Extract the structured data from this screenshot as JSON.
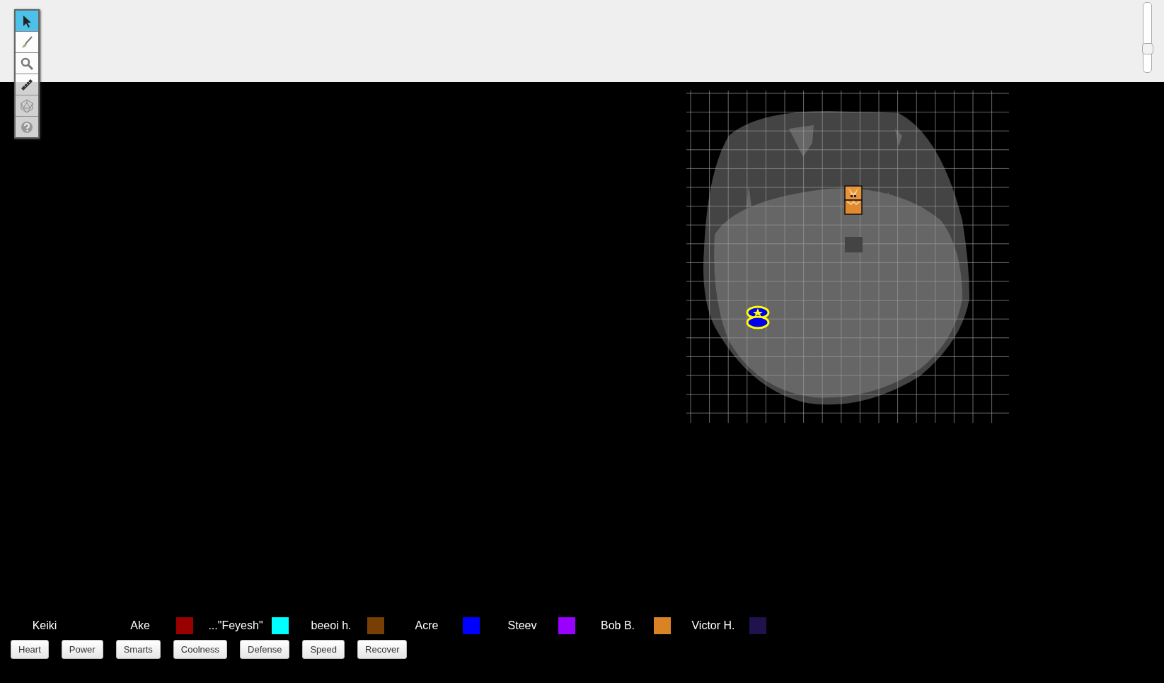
{
  "toolbar": {
    "tools": [
      {
        "kind": "select",
        "selected": true
      },
      {
        "kind": "brush",
        "selected": false
      },
      {
        "kind": "zoom",
        "selected": false
      },
      {
        "kind": "ruler",
        "selected": false
      },
      {
        "kind": "dice",
        "selected": false
      },
      {
        "kind": "help",
        "selected": false
      }
    ]
  },
  "zoom_slider": {
    "level": 0.3
  },
  "players": [
    {
      "name": "Keiki"
    },
    {
      "name": "Ake",
      "color": "#990000"
    },
    {
      "name": "...\"Feyesh\"",
      "color": "#00ffff"
    },
    {
      "name": "beeoi h.",
      "color": "#783f04"
    },
    {
      "name": "Acre",
      "color": "#0000ff"
    },
    {
      "name": "Steev",
      "color": "#9900ff"
    },
    {
      "name": "Bob B.",
      "color": "#d98324"
    },
    {
      "name": "Victor H.",
      "color": "#20124d"
    }
  ],
  "macro_buttons": [
    "Heart",
    "Power",
    "Smarts",
    "Coolness",
    "Defense",
    "Speed",
    "Recover"
  ]
}
